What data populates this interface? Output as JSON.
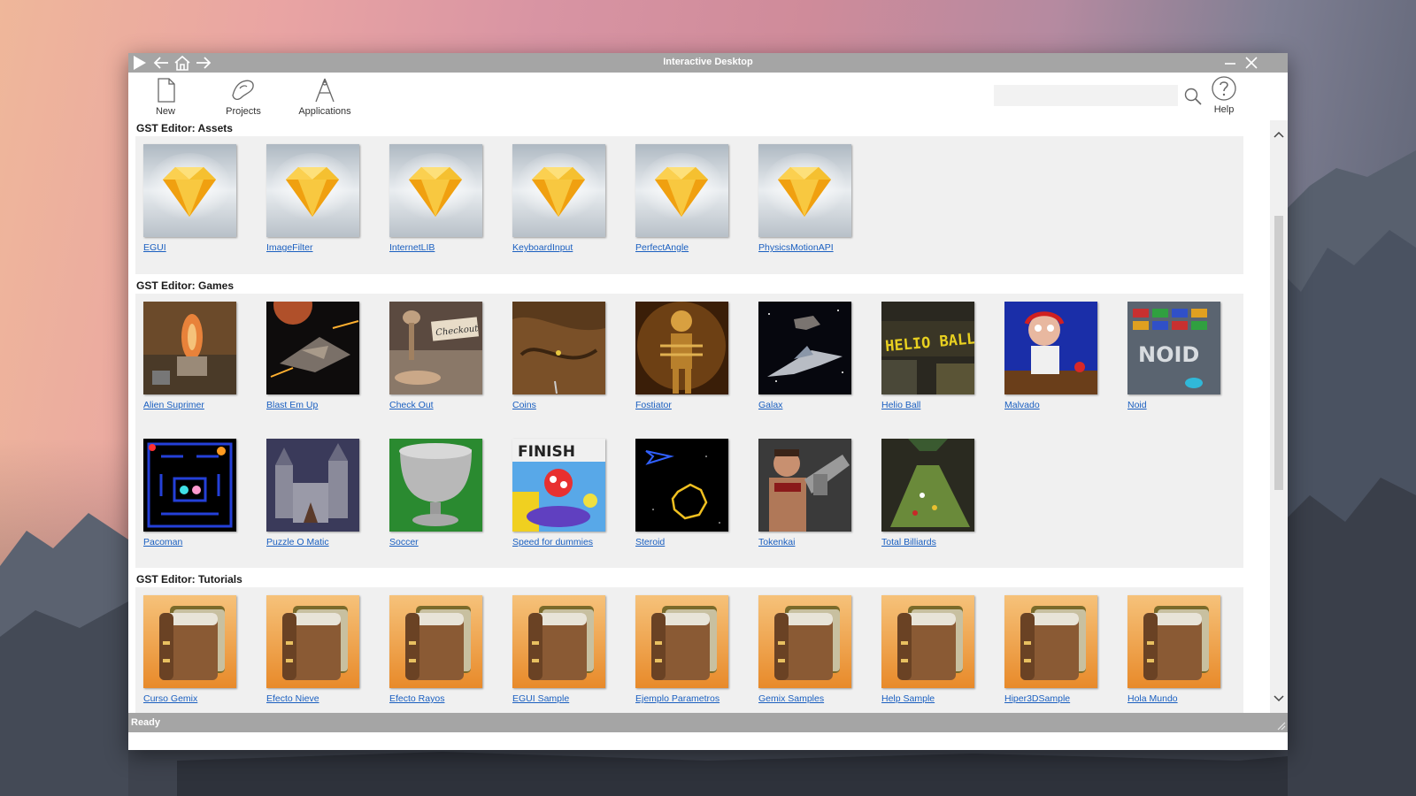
{
  "window": {
    "title": "Interactive Desktop",
    "status": "Ready"
  },
  "toolbar": {
    "new_label": "New",
    "projects_label": "Projects",
    "applications_label": "Applications",
    "help_label": "Help",
    "search_value": "",
    "search_placeholder": ""
  },
  "sections": {
    "assets": {
      "title": "GST Editor: Assets",
      "items": [
        "EGUI",
        "ImageFilter",
        "InternetLIB",
        "KeyboardInput",
        "PerfectAngle",
        "PhysicsMotionAPI"
      ]
    },
    "games": {
      "title": "GST Editor: Games",
      "items": [
        "Alien Suprimer",
        "Blast Em Up",
        "Check Out",
        "Coins",
        "Fostiator",
        "Galax",
        "Helio Ball",
        "Malvado",
        "Noid",
        "Pacoman",
        "Puzzle O Matic",
        "Soccer",
        "Speed for dummies",
        "Steroid",
        "Tokenkai",
        "Total Billiards"
      ]
    },
    "tutorials": {
      "title": "GST Editor: Tutorials",
      "items": [
        "Curso Gemix",
        "Efecto Nieve",
        "Efecto Rayos",
        "EGUI Sample",
        "Ejemplo Parametros",
        "Gemix Samples",
        "Help Sample",
        "Hiper3DSample",
        "Hola Mundo"
      ]
    }
  },
  "thumb_text": {
    "checkout_sign": "Checkout",
    "helio_sign": "HELIO BALL",
    "speed_sign": "FINISH",
    "noid_logo": "NOID"
  },
  "colors": {
    "titlebar": "#a5a5a5",
    "link": "#1a5fc0",
    "panel": "#f0f0f0",
    "gem": "#f7b825",
    "book": "#8a5a34"
  },
  "icons": {
    "play": "play-icon",
    "back": "arrow-left-icon",
    "home": "home-icon",
    "forward": "arrow-right-icon",
    "minimize": "minimize-icon",
    "close": "close-icon",
    "new": "new-document-icon",
    "projects": "projects-icon",
    "applications": "applications-icon",
    "search": "search-icon",
    "help": "help-icon"
  }
}
